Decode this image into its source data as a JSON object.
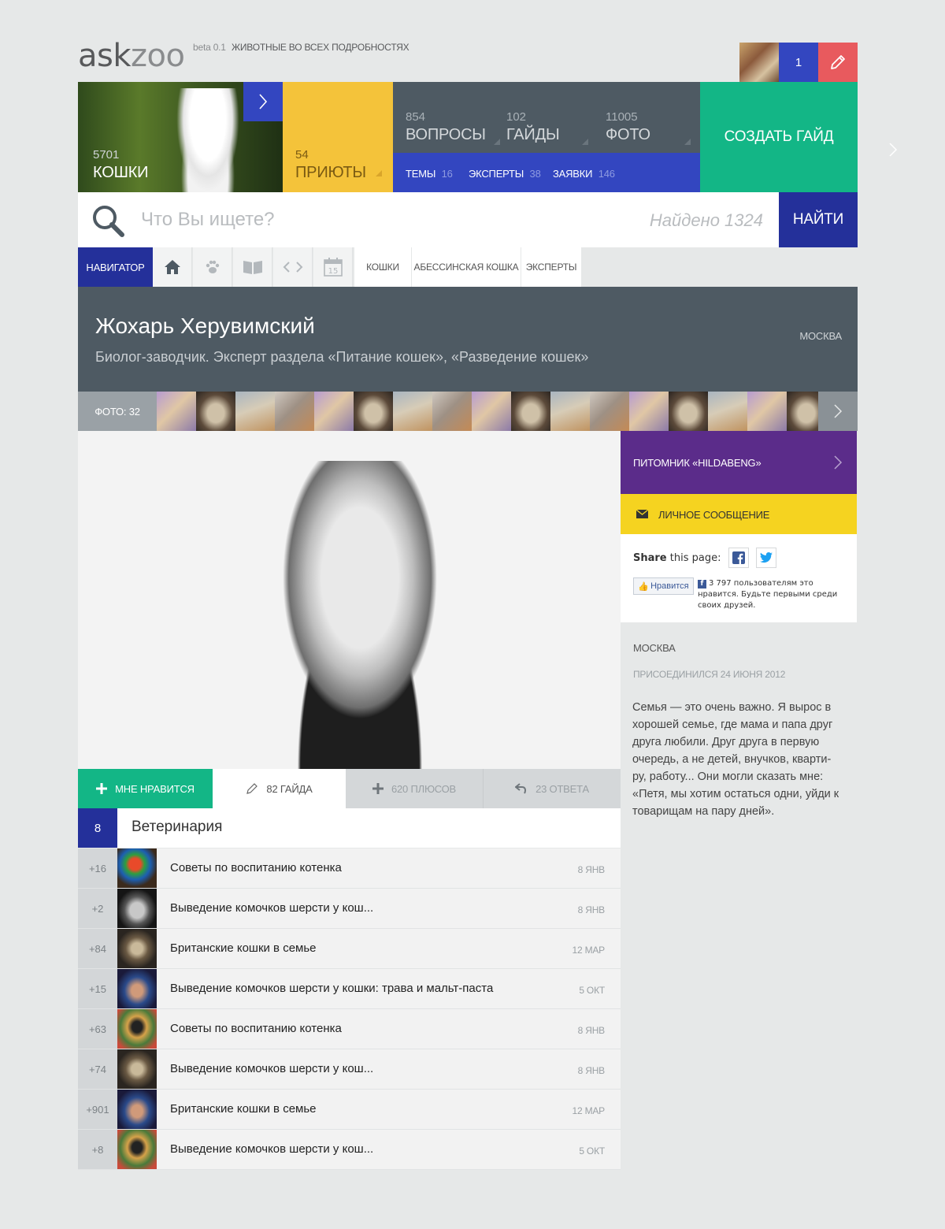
{
  "header": {
    "logo_ask": "ask",
    "logo_zoo": "zoo",
    "beta": "beta 0.1",
    "tagline": "ЖИВОТНЫЕ ВО ВСЕХ ПОДРОБНОСТЯХ",
    "notifications": "1"
  },
  "tiles": {
    "cats": {
      "count": "5701",
      "label": "КОШКИ"
    },
    "shelters": {
      "count": "54",
      "label": "ПРИЮТЫ"
    },
    "questions": {
      "count": "854",
      "label": "ВОПРОСЫ"
    },
    "guides": {
      "count": "102",
      "label": "ГАЙДЫ"
    },
    "photos": {
      "count": "11005",
      "label": "ФОТО"
    },
    "topics": {
      "label": "ТЕМЫ",
      "count": "16"
    },
    "experts": {
      "label": "ЭКСПЕРТЫ",
      "count": "38"
    },
    "requests": {
      "label": "ЗАЯВКИ",
      "count": "146"
    },
    "create_guide": "СОЗДАТЬ ГАЙД"
  },
  "search": {
    "placeholder": "Что Вы ищете?",
    "found": "Найдено 1324",
    "button": "НАЙТИ"
  },
  "navigator": {
    "label": "НАВИГАТОР",
    "calendar_day": "15",
    "crumbs": [
      "КОШКИ",
      "АБЕССИНСКАЯ КОШКА",
      "ЭКСПЕРТЫ"
    ]
  },
  "profile": {
    "name": "Жохарь Херувимский",
    "description": "Биолог-заводчик. Эксперт раздела «Питание кошек», «Разведение кошек»",
    "city": "МОСКВА",
    "photos_label": "ФОТО: 32"
  },
  "actions": {
    "like": "МНЕ НРАВИТСЯ",
    "guides": "82 ГАЙДА",
    "pluses": "620 ПЛЮСОВ",
    "answers": "23 ОТВЕТА"
  },
  "category": {
    "count": "8",
    "title": "Ветеринария"
  },
  "list": [
    {
      "score": "+16",
      "title": "Советы по воспитанию котенка",
      "date": "8 ЯНВ"
    },
    {
      "score": "+2",
      "title": "Выведение комочков шерсти у кош...",
      "date": "8 ЯНВ"
    },
    {
      "score": "+84",
      "title": "Британские кошки в семье",
      "date": "12 МАР"
    },
    {
      "score": "+15",
      "title": "Выведение комочков шерсти у кошки: трава и мальт-паста",
      "date": "5 ОКТ"
    },
    {
      "score": "+63",
      "title": "Советы по воспитанию котенка",
      "date": "8 ЯНВ"
    },
    {
      "score": "+74",
      "title": "Выведение комочков шерсти у кош...",
      "date": "8 ЯНВ"
    },
    {
      "score": "+901",
      "title": "Британские кошки в семье",
      "date": "12 МАР"
    },
    {
      "score": "+8",
      "title": "Выведение комочков шерсти у кош...",
      "date": "5 ОКТ"
    }
  ],
  "sidebar": {
    "kennel": "ПИТОМНИК «HILDABENG»",
    "message": "ЛИЧНОЕ СООБЩЕНИЕ",
    "share_bold": "Share",
    "share_rest": " this page:",
    "like_button": "Нравится",
    "like_text": "3 797 пользователям это нравится. Будьте первыми среди своих друзей.",
    "city": "МОСКВА",
    "joined": "ПРИСОЕДИНИЛСЯ 24 ИЮНЯ 2012",
    "bio": "Семья — это очень важно. Я вырос в хорошей семье, где мама и папа друг друга любили. Друг друга в первую очередь, а не детей, внучков, кварти-ру, работу... Они могли сказать мне: «Петя, мы хотим остаться одни, уйди к товарищам на пару дней»."
  },
  "colors": {
    "blue": "#3346c0",
    "navy": "#24309a",
    "green": "#13b686",
    "yellow": "#f4c33a",
    "slate": "#4e5a63",
    "purple": "#5b2c8a",
    "red": "#e85a5e"
  }
}
